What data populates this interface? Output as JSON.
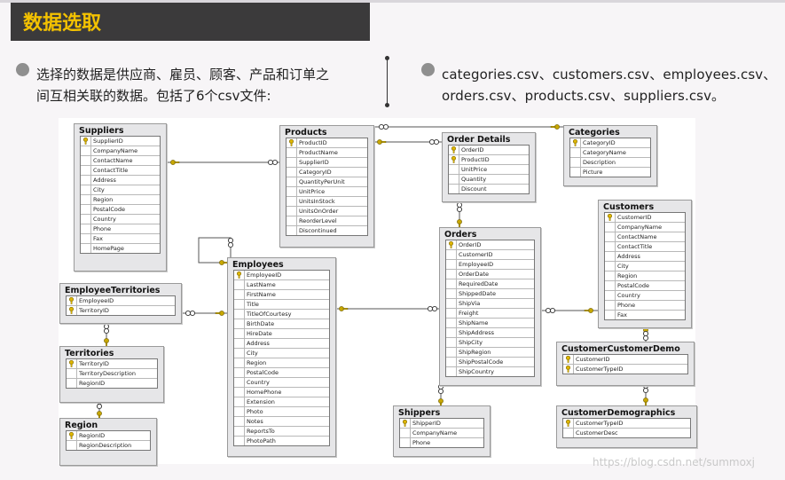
{
  "header": {
    "title": "数据选取"
  },
  "intro": {
    "left_line1": "选择的数据是供应商、雇员、顾客、产品和订单之",
    "left_line2": "间互相关联的数据。包括了6个csv文件:",
    "right_line1": "categories.csv、customers.csv、employees.csv、",
    "right_line2": "orders.csv、products.csv、suppliers.csv。"
  },
  "colors": {
    "title_bar": "#3b3a3b",
    "title_text": "#f4c200",
    "key_icon": "#e0b800",
    "connector": "#c8a800"
  },
  "tables": [
    {
      "name": "Suppliers",
      "fields": [
        "SupplierID",
        "CompanyName",
        "ContactName",
        "ContactTitle",
        "Address",
        "City",
        "Region",
        "PostalCode",
        "Country",
        "Phone",
        "Fax",
        "HomePage"
      ],
      "keys": [
        0
      ]
    },
    {
      "name": "Products",
      "fields": [
        "ProductID",
        "ProductName",
        "SupplierID",
        "CategoryID",
        "QuantityPerUnit",
        "UnitPrice",
        "UnitsInStock",
        "UnitsOnOrder",
        "ReorderLevel",
        "Discontinued"
      ],
      "keys": [
        0
      ]
    },
    {
      "name": "Order Details",
      "fields": [
        "OrderID",
        "ProductID",
        "UnitPrice",
        "Quantity",
        "Discount"
      ],
      "keys": [
        0,
        1
      ]
    },
    {
      "name": "Categories",
      "fields": [
        "CategoryID",
        "CategoryName",
        "Description",
        "Picture"
      ],
      "keys": [
        0
      ]
    },
    {
      "name": "Customers",
      "fields": [
        "CustomerID",
        "CompanyName",
        "ContactName",
        "ContactTitle",
        "Address",
        "City",
        "Region",
        "PostalCode",
        "Country",
        "Phone",
        "Fax"
      ],
      "keys": [
        0
      ]
    },
    {
      "name": "Orders",
      "fields": [
        "OrderID",
        "CustomerID",
        "EmployeeID",
        "OrderDate",
        "RequiredDate",
        "ShippedDate",
        "ShipVia",
        "Freight",
        "ShipName",
        "ShipAddress",
        "ShipCity",
        "ShipRegion",
        "ShipPostalCode",
        "ShipCountry"
      ],
      "keys": [
        0
      ]
    },
    {
      "name": "Employees",
      "fields": [
        "EmployeeID",
        "LastName",
        "FirstName",
        "Title",
        "TitleOfCourtesy",
        "BirthDate",
        "HireDate",
        "Address",
        "City",
        "Region",
        "PostalCode",
        "Country",
        "HomePhone",
        "Extension",
        "Photo",
        "Notes",
        "ReportsTo",
        "PhotoPath"
      ],
      "keys": [
        0
      ]
    },
    {
      "name": "EmployeeTerritories",
      "fields": [
        "EmployeeID",
        "TerritoryID"
      ],
      "keys": [
        0,
        1
      ]
    },
    {
      "name": "Territories",
      "fields": [
        "TerritoryID",
        "TerritoryDescription",
        "RegionID"
      ],
      "keys": [
        0
      ]
    },
    {
      "name": "Region",
      "fields": [
        "RegionID",
        "RegionDescription"
      ],
      "keys": [
        0
      ]
    },
    {
      "name": "Shippers",
      "fields": [
        "ShipperID",
        "CompanyName",
        "Phone"
      ],
      "keys": [
        0
      ]
    },
    {
      "name": "CustomerCustomerDemo",
      "fields": [
        "CustomerID",
        "CustomerTypeID"
      ],
      "keys": [
        0,
        1
      ]
    },
    {
      "name": "CustomerDemographics",
      "fields": [
        "CustomerTypeID",
        "CustomerDesc"
      ],
      "keys": [
        0
      ]
    }
  ],
  "watermark": "https://blog.csdn.net/summoxj"
}
